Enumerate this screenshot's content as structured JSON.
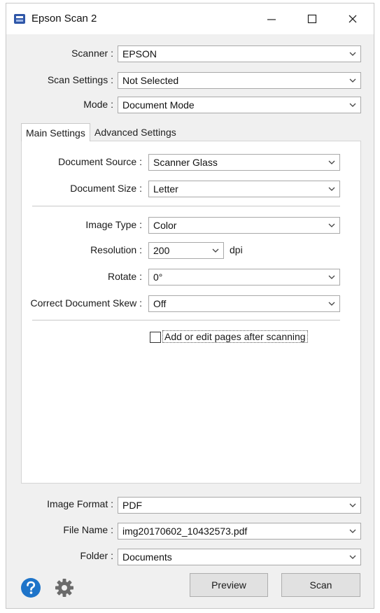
{
  "window": {
    "title": "Epson Scan 2"
  },
  "top": {
    "scanner": {
      "label": "Scanner :",
      "value": "EPSON"
    },
    "scan_settings": {
      "label": "Scan Settings :",
      "value": "Not Selected"
    },
    "mode": {
      "label": "Mode :",
      "value": "Document Mode"
    }
  },
  "tabs": [
    {
      "label": "Main Settings",
      "active": true
    },
    {
      "label": "Advanced Settings",
      "active": false
    }
  ],
  "main": {
    "document_source": {
      "label": "Document Source :",
      "value": "Scanner Glass"
    },
    "document_size": {
      "label": "Document Size :",
      "value": "Letter"
    },
    "image_type": {
      "label": "Image Type :",
      "value": "Color"
    },
    "resolution": {
      "label": "Resolution :",
      "value": "200",
      "unit": "dpi"
    },
    "rotate": {
      "label": "Rotate :",
      "value": "0°"
    },
    "skew": {
      "label": "Correct Document Skew :",
      "value": "Off"
    },
    "add_pages": {
      "label": "Add or edit pages after scanning",
      "checked": false
    }
  },
  "bottom": {
    "image_format": {
      "label": "Image Format :",
      "value": "PDF"
    },
    "file_name": {
      "label": "File Name :",
      "value": "img20170602_10432573.pdf"
    },
    "folder": {
      "label": "Folder :",
      "value": "Documents"
    }
  },
  "buttons": {
    "preview": "Preview",
    "scan": "Scan"
  },
  "colors": {
    "help_blue": "#1e74c9",
    "gear_gray": "#6b6b6b",
    "app_icon_blue": "#2f57a8"
  },
  "icons": [
    "app-icon",
    "minimize-icon",
    "maximize-icon",
    "close-icon",
    "chevron-down-icon",
    "help-icon",
    "gear-icon"
  ]
}
